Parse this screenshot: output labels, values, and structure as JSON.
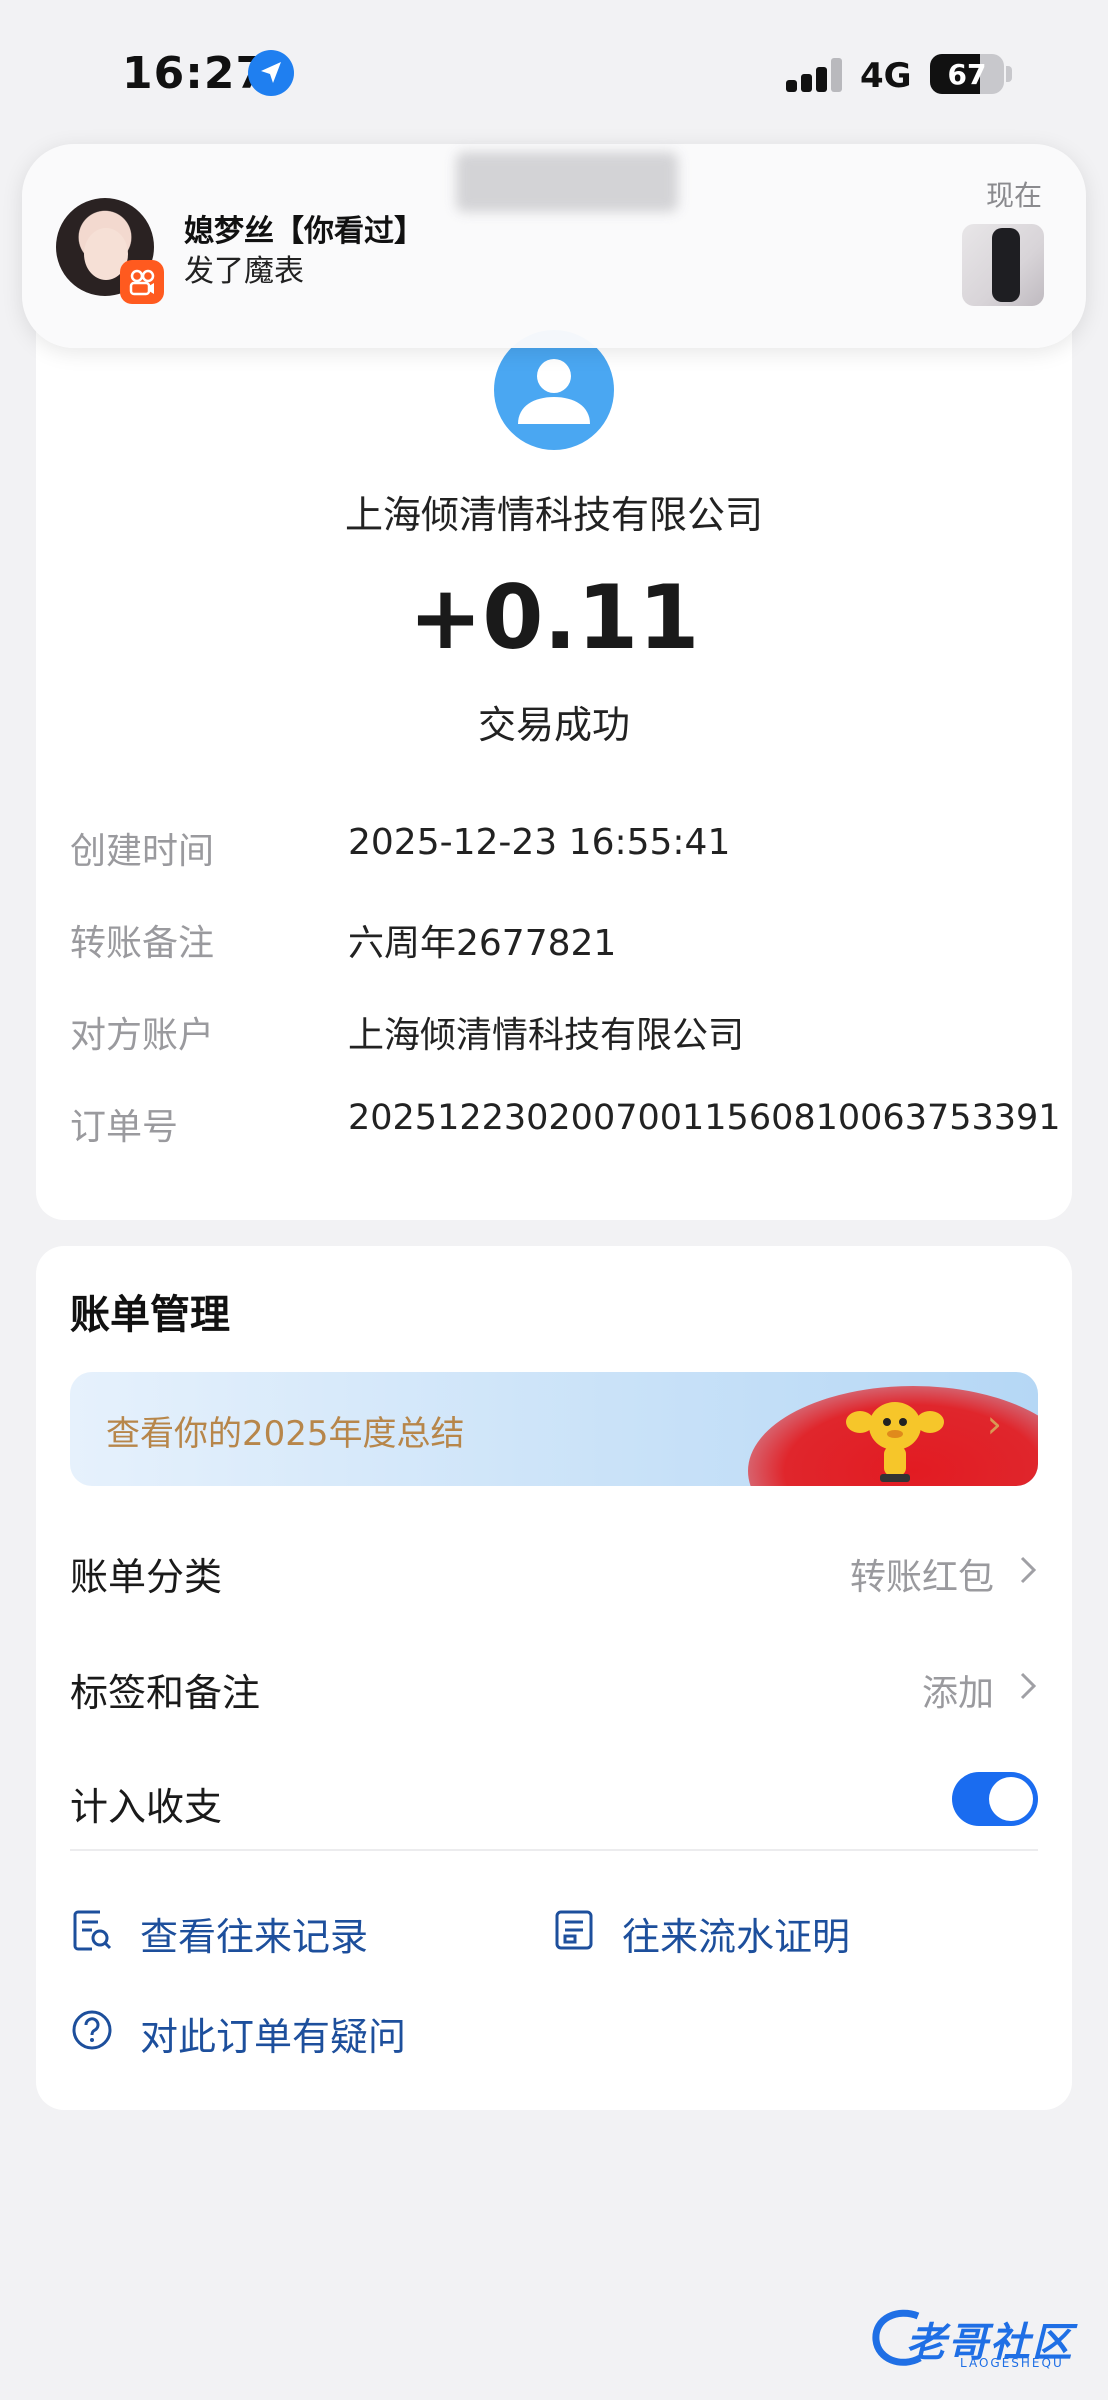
{
  "status_bar": {
    "time": "16:27",
    "network": "4G",
    "battery": "67",
    "battery_level": 0.67,
    "icons": [
      "location-arrow-icon",
      "signal-bars-icon",
      "battery-icon"
    ]
  },
  "notification": {
    "title": "媳梦丝【你看过】",
    "body": "发了魔表",
    "time": "现在",
    "app_icon": "kuaishou-app-icon"
  },
  "transaction": {
    "avatar_icon": "default-user-avatar-icon",
    "payee": "上海倾清情科技有限公司",
    "amount": "+0.11",
    "status": "交易成功",
    "details": [
      {
        "label": "创建时间",
        "value": "2025-12-23 16:55:41"
      },
      {
        "label": "转账备注",
        "value": "六周年2677821"
      },
      {
        "label": "对方账户",
        "value": "上海倾清情科技有限公司"
      },
      {
        "label": "订单号",
        "value": "2025122302007001156081006375339​1"
      }
    ]
  },
  "bill_management": {
    "title": "账单管理",
    "banner_text": "查看你的2025年度总结",
    "category_label": "账单分类",
    "category_value": "转账红包",
    "tags_label": "标签和备注",
    "tags_value": "添加",
    "include_label": "计入收支",
    "include_on": true,
    "links": {
      "records": "查看往来记录",
      "certificate": "往来流水证明",
      "question": "对此订单有疑问"
    }
  },
  "watermark": {
    "text": "老哥社区",
    "sub": "LAOGESHEQU"
  },
  "colors": {
    "accent": "#1a6cf0",
    "link": "#1d4f9c",
    "banner_text": "#b7864a"
  }
}
